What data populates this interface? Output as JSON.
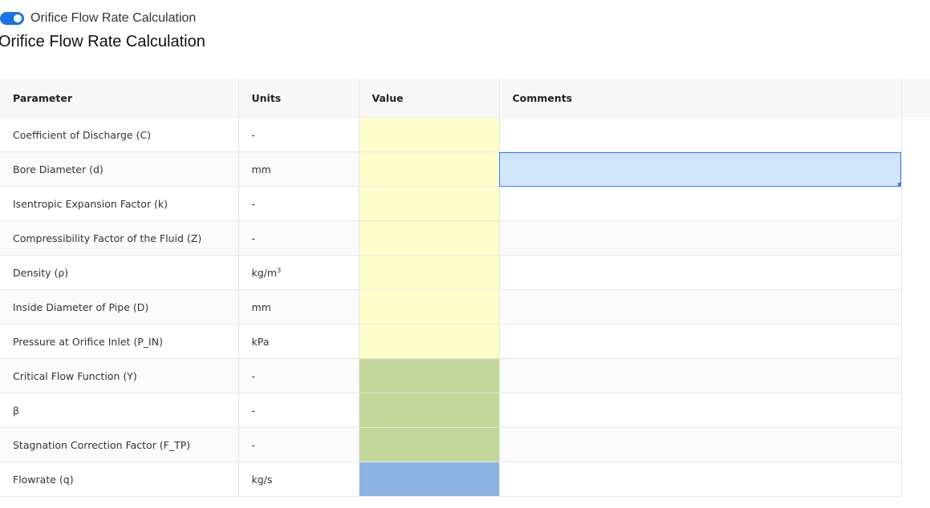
{
  "toggle": {
    "label": "Orifice Flow Rate Calculation",
    "state": "on",
    "color": "#1a73e8"
  },
  "page_title": "Orifice Flow Rate Calculation",
  "colors": {
    "input": "#ffffcc",
    "calculated": "#c4d79b",
    "result": "#8db4e2",
    "selection": "#2f80ed"
  },
  "table": {
    "headers": {
      "parameter": "Parameter",
      "units": "Units",
      "value": "Value",
      "comments": "Comments"
    },
    "rows": [
      {
        "parameter": "Coefficient of Discharge (C)",
        "units": "-",
        "value": "",
        "comments": "",
        "kind": "input"
      },
      {
        "parameter": "Bore Diameter (d)",
        "units": "mm",
        "value": "",
        "comments": "",
        "kind": "input"
      },
      {
        "parameter": "Isentropic Expansion Factor (k)",
        "units": "-",
        "value": "",
        "comments": "",
        "kind": "input"
      },
      {
        "parameter": "Compressibility Factor of the Fluid (Z)",
        "units": "-",
        "value": "",
        "comments": "",
        "kind": "input"
      },
      {
        "parameter": "Density (ρ)",
        "units": "kg/m",
        "units_sup": "3",
        "value": "",
        "comments": "",
        "kind": "input"
      },
      {
        "parameter": "Inside Diameter of Pipe (D)",
        "units": "mm",
        "value": "",
        "comments": "",
        "kind": "input"
      },
      {
        "parameter": "Pressure at Orifice Inlet (P_IN)",
        "units": "kPa",
        "value": "",
        "comments": "",
        "kind": "input"
      },
      {
        "parameter": "Critical Flow Function (Y)",
        "units": "-",
        "value": "",
        "comments": "",
        "kind": "calculated"
      },
      {
        "parameter": "β",
        "units": "-",
        "value": "",
        "comments": "",
        "kind": "calculated"
      },
      {
        "parameter": "Stagnation Correction Factor (F_TP)",
        "units": "-",
        "value": "",
        "comments": "",
        "kind": "calculated"
      },
      {
        "parameter": "Flowrate (q)",
        "units": "kg/s",
        "value": "",
        "comments": "",
        "kind": "result"
      }
    ]
  }
}
